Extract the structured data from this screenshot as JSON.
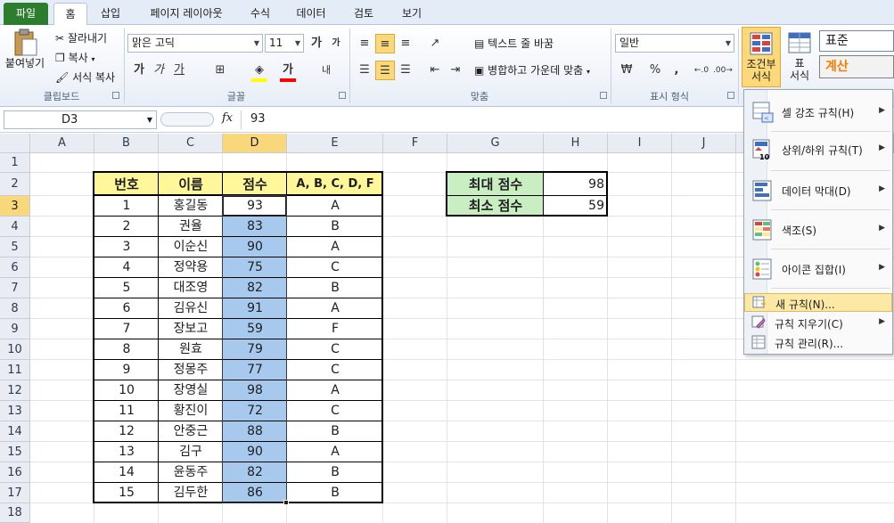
{
  "tabs": [
    "파일",
    "홈",
    "삽입",
    "페이지 레이아웃",
    "수식",
    "데이터",
    "검토",
    "보기"
  ],
  "ribbon": {
    "clipboard": {
      "paste": "붙여넣기",
      "cut": "잘라내기",
      "copy": "복사",
      "format_painter": "서식 복사",
      "group": "클립보드"
    },
    "font": {
      "name": "맑은 고딕",
      "size": "11",
      "grow": "가",
      "shrink": "가",
      "bold": "가",
      "italic": "가",
      "underline": "가",
      "fill_color": "#ffff00",
      "font_color": "#ff0000",
      "group": "글꼴"
    },
    "alignment": {
      "wrap_text": "텍스트 줄 바꿈",
      "merge_center": "병합하고 가운데 맞춤",
      "group": "맞춤"
    },
    "number": {
      "format": "일반",
      "percent": "%",
      "comma": ",",
      "group": "표시 형식"
    },
    "styles": {
      "conditional_format": "조건부\n서식",
      "format_table": "표\n서식",
      "style_normal": "표준",
      "style_calc": "계산"
    }
  },
  "formula_bar": {
    "name_box": "D3",
    "fx": "fx",
    "value": "93"
  },
  "grid": {
    "columns": [
      "A",
      "B",
      "C",
      "D",
      "E",
      "F",
      "G",
      "H",
      "I",
      "J"
    ],
    "selected_column": "D",
    "rows": [
      "1",
      "2",
      "3",
      "4",
      "5",
      "6",
      "7",
      "8",
      "9",
      "10",
      "11",
      "12",
      "13",
      "14",
      "15",
      "16",
      "17",
      "18"
    ],
    "table_headers": [
      "번호",
      "이름",
      "점수",
      "A, B, C, D, F"
    ],
    "table_rows": [
      [
        "1",
        "홍길동",
        "93",
        "A"
      ],
      [
        "2",
        "권율",
        "83",
        "B"
      ],
      [
        "3",
        "이순신",
        "90",
        "A"
      ],
      [
        "4",
        "정약용",
        "75",
        "C"
      ],
      [
        "5",
        "대조영",
        "82",
        "B"
      ],
      [
        "6",
        "김유신",
        "91",
        "A"
      ],
      [
        "7",
        "장보고",
        "59",
        "F"
      ],
      [
        "8",
        "원효",
        "79",
        "C"
      ],
      [
        "9",
        "정몽주",
        "77",
        "C"
      ],
      [
        "10",
        "장영실",
        "98",
        "A"
      ],
      [
        "11",
        "황진이",
        "72",
        "C"
      ],
      [
        "12",
        "안중근",
        "88",
        "B"
      ],
      [
        "13",
        "김구",
        "90",
        "A"
      ],
      [
        "14",
        "윤동주",
        "82",
        "B"
      ],
      [
        "15",
        "김두한",
        "86",
        "B"
      ]
    ],
    "summary": [
      {
        "label": "최대 점수",
        "value": "98"
      },
      {
        "label": "최소 점수",
        "value": "59"
      }
    ],
    "colors": {
      "header_fill": "#fff79a",
      "summary_fill": "#c8eec2",
      "selection_fill": "#a7c9ee",
      "active_header": "#f9d87c"
    }
  },
  "cf_menu": {
    "items": [
      {
        "label": "셀 강조 규칙(H)",
        "icon": "highlight-cells-icon",
        "submenu": true
      },
      {
        "label": "상위/하위 규칙(T)",
        "icon": "top-bottom-icon",
        "submenu": true
      },
      {
        "label": "데이터 막대(D)",
        "icon": "data-bars-icon",
        "submenu": true
      },
      {
        "label": "색조(S)",
        "icon": "color-scales-icon",
        "submenu": true
      },
      {
        "label": "아이콘 집합(I)",
        "icon": "icon-sets-icon",
        "submenu": true
      }
    ],
    "small_items": [
      {
        "label": "새 규칙(N)...",
        "icon": "new-rule-icon",
        "submenu": false,
        "highlighted": true
      },
      {
        "label": "규칙 지우기(C)",
        "icon": "clear-rules-icon",
        "submenu": true
      },
      {
        "label": "규칙 관리(R)...",
        "icon": "manage-rules-icon",
        "submenu": false
      }
    ]
  }
}
